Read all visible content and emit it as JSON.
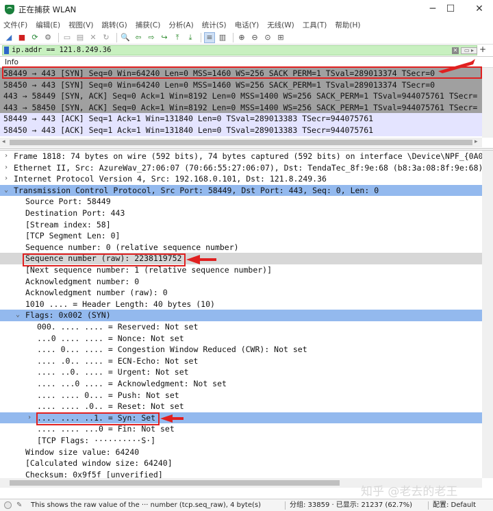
{
  "window": {
    "title": "正在捕获 WLAN",
    "controls": {
      "minimize": "─",
      "maximize": "☐",
      "close": "✕"
    }
  },
  "menu": [
    "文件(F)",
    "编辑(E)",
    "视图(V)",
    "跳转(G)",
    "捕获(C)",
    "分析(A)",
    "统计(S)",
    "电话(Y)",
    "无线(W)",
    "工具(T)",
    "帮助(H)"
  ],
  "toolbar": {
    "icons": [
      "shark-fin-icon",
      "stop-icon",
      "restart-icon",
      "options-gear-icon",
      "open-file-icon",
      "save-file-icon",
      "close-file-icon",
      "reload-icon",
      "find-icon",
      "back-arrow-icon",
      "forward-arrow-icon",
      "goto-packet-icon",
      "first-packet-icon",
      "last-packet-icon",
      "autoscroll-icon",
      "colorize-icon",
      "zoom-in-icon",
      "zoom-out-icon",
      "zoom-reset-icon",
      "resize-columns-icon"
    ]
  },
  "filter": {
    "value": "ip.addr == 121.8.249.36",
    "apply_label": "▭ ▸",
    "add_label": "+"
  },
  "packet_list": {
    "column_header": "Info",
    "rows": [
      {
        "info": "58449 → 443 [SYN] Seq=0 Win=64240 Len=0 MSS=1460 WS=256 SACK_PERM=1 TSval=289013374 TSecr=0",
        "style": "gray"
      },
      {
        "info": "58450 → 443 [SYN] Seq=0 Win=64240 Len=0 MSS=1460 WS=256 SACK_PERM=1 TSval=289013374 TSecr=0",
        "style": "gray"
      },
      {
        "info": "443 → 58449 [SYN, ACK] Seq=0 Ack=1 Win=8192 Len=0 MSS=1400 WS=256 SACK_PERM=1 TSval=944075761 TSecr=",
        "style": "gray"
      },
      {
        "info": "443 → 58450 [SYN, ACK] Seq=0 Ack=1 Win=8192 Len=0 MSS=1400 WS=256 SACK_PERM=1 TSval=944075761 TSecr=",
        "style": "gray"
      },
      {
        "info": "58449 → 443 [ACK] Seq=1 Ack=1 Win=131840 Len=0 TSval=289013383 TSecr=944075761",
        "style": "light"
      },
      {
        "info": "58450 → 443 [ACK] Seq=1 Ack=1 Win=131840 Len=0 TSval=289013383 TSecr=944075761",
        "style": "light"
      }
    ]
  },
  "details": {
    "rows": [
      {
        "text": "Frame 1818: 74 bytes on wire (592 bits), 74 bytes captured (592 bits) on interface \\Device\\NPF_{0A0",
        "tw": "›",
        "indent": 0,
        "style": ""
      },
      {
        "text": "Ethernet II, Src: AzureWav_27:06:07 (70:66:55:27:06:07), Dst: TendaTec_8f:9e:68 (b8:3a:08:8f:9e:68)",
        "tw": "›",
        "indent": 0,
        "style": ""
      },
      {
        "text": "Internet Protocol Version 4, Src: 192.168.0.101, Dst: 121.8.249.36",
        "tw": "›",
        "indent": 0,
        "style": ""
      },
      {
        "text": "Transmission Control Protocol, Src Port: 58449, Dst Port: 443, Seq: 0, Len: 0",
        "tw": "⌄",
        "indent": 0,
        "style": "sel"
      },
      {
        "text": "Source Port: 58449",
        "tw": "",
        "indent": 1,
        "style": ""
      },
      {
        "text": "Destination Port: 443",
        "tw": "",
        "indent": 1,
        "style": ""
      },
      {
        "text": "[Stream index: 58]",
        "tw": "",
        "indent": 1,
        "style": ""
      },
      {
        "text": "[TCP Segment Len: 0]",
        "tw": "",
        "indent": 1,
        "style": ""
      },
      {
        "text": "Sequence number: 0    (relative sequence number)",
        "tw": "",
        "indent": 1,
        "style": ""
      },
      {
        "text": "Sequence number (raw): 2238119752",
        "tw": "",
        "indent": 1,
        "style": "hl"
      },
      {
        "text": "[Next sequence number: 1    (relative sequence number)]",
        "tw": "",
        "indent": 1,
        "style": ""
      },
      {
        "text": "Acknowledgment number: 0",
        "tw": "",
        "indent": 1,
        "style": ""
      },
      {
        "text": "Acknowledgment number (raw): 0",
        "tw": "",
        "indent": 1,
        "style": ""
      },
      {
        "text": "1010 .... = Header Length: 40 bytes (10)",
        "tw": "",
        "indent": 1,
        "style": ""
      },
      {
        "text": "Flags: 0x002 (SYN)",
        "tw": "⌄",
        "indent": 1,
        "style": "sel"
      },
      {
        "text": "000. .... .... = Reserved: Not set",
        "tw": "",
        "indent": 2,
        "style": ""
      },
      {
        "text": "...0 .... .... = Nonce: Not set",
        "tw": "",
        "indent": 2,
        "style": ""
      },
      {
        "text": ".... 0... .... = Congestion Window Reduced (CWR): Not set",
        "tw": "",
        "indent": 2,
        "style": ""
      },
      {
        "text": ".... .0.. .... = ECN-Echo: Not set",
        "tw": "",
        "indent": 2,
        "style": ""
      },
      {
        "text": ".... ..0. .... = Urgent: Not set",
        "tw": "",
        "indent": 2,
        "style": ""
      },
      {
        "text": ".... ...0 .... = Acknowledgment: Not set",
        "tw": "",
        "indent": 2,
        "style": ""
      },
      {
        "text": ".... .... 0... = Push: Not set",
        "tw": "",
        "indent": 2,
        "style": ""
      },
      {
        "text": ".... .... .0.. = Reset: Not set",
        "tw": "",
        "indent": 2,
        "style": ""
      },
      {
        "text": ".... .... ..1. = Syn: Set",
        "tw": "›",
        "indent": 2,
        "style": "sel"
      },
      {
        "text": ".... .... ...0 = Fin: Not set",
        "tw": "",
        "indent": 2,
        "style": ""
      },
      {
        "text": "[TCP Flags: ··········S·]",
        "tw": "",
        "indent": 2,
        "style": ""
      },
      {
        "text": "Window size value: 64240",
        "tw": "",
        "indent": 1,
        "style": ""
      },
      {
        "text": "[Calculated window size: 64240]",
        "tw": "",
        "indent": 1,
        "style": ""
      },
      {
        "text": "Checksum: 0x9f5f [unverified]",
        "tw": "",
        "indent": 1,
        "style": ""
      }
    ]
  },
  "status": {
    "hint": "This shows the raw value of the ··· number (tcp.seq_raw), 4 byte(s)",
    "packets": "分组: 33859 · 已显示: 21237 (62.7%)",
    "profile": "配置: Default"
  },
  "watermark": "知乎 @老去的老王",
  "colors": {
    "selected": "#93b9ee",
    "annotation": "#e02020",
    "filter_ok": "#c8f0c0"
  }
}
